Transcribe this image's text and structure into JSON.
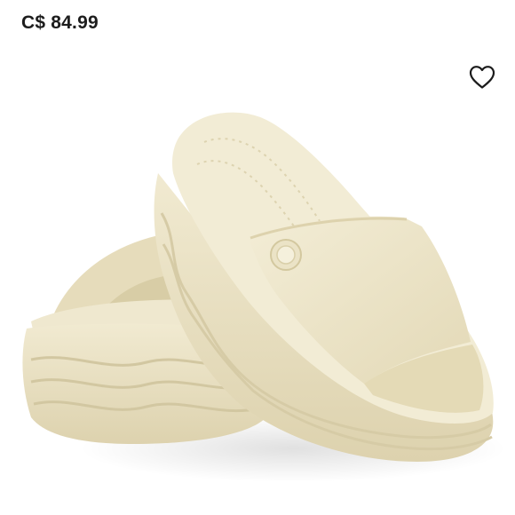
{
  "product": {
    "price": "C$ 84.99",
    "image_colors": {
      "sandal": "#ece4c8",
      "sandal_shadow": "#d3c8a6",
      "sole_band": "#e2d9b8"
    }
  },
  "icons": {
    "favorite": "heart-outline-icon"
  }
}
